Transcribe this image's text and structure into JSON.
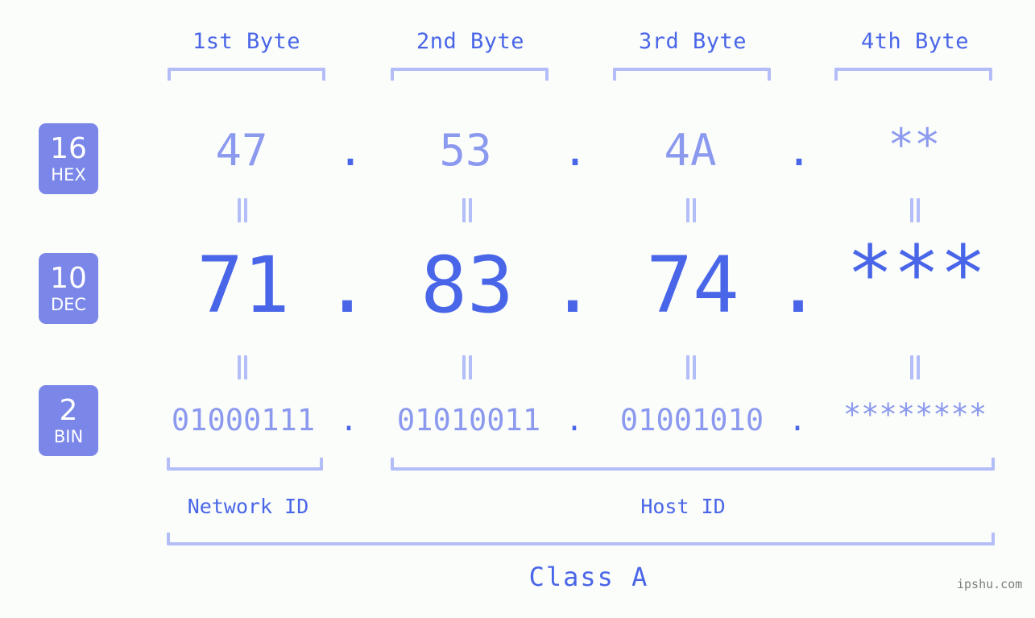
{
  "watermark": "ipshu.com",
  "byte_headers": [
    {
      "label": "1st Byte"
    },
    {
      "label": "2nd Byte"
    },
    {
      "label": "3rd Byte"
    },
    {
      "label": "4th Byte"
    }
  ],
  "radix_rows": [
    {
      "base": "16",
      "name": "HEX",
      "values": [
        "47",
        "53",
        "4A",
        "**"
      ],
      "separator": "."
    },
    {
      "base": "10",
      "name": "DEC",
      "values": [
        "71",
        "83",
        "74",
        "***"
      ],
      "separator": "."
    },
    {
      "base": "2",
      "name": "BIN",
      "values": [
        "01000111",
        "01010011",
        "01001010",
        "********"
      ],
      "separator": "."
    }
  ],
  "sections": [
    {
      "label": "Network ID"
    },
    {
      "label": "Host ID"
    }
  ],
  "class": {
    "label": "Class A"
  },
  "colors": {
    "background": "#fbfdfa",
    "accent_strong": "#4a66e8",
    "accent_light": "#8b99ef",
    "bracket": "#b3bdf7",
    "badge_bg": "#7b87e8",
    "badge_text": "#ffffff",
    "watermark": "#7d7d7d"
  }
}
